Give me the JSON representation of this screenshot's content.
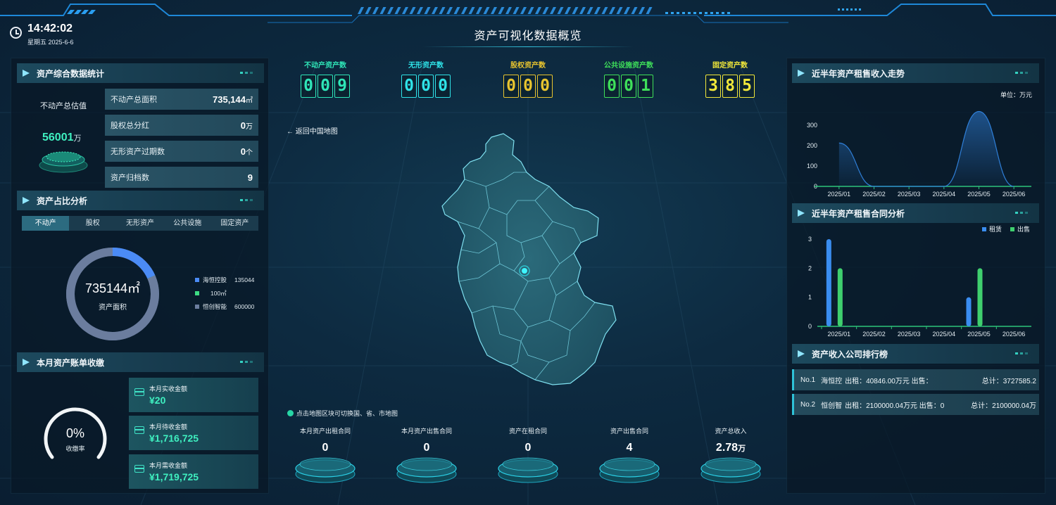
{
  "header": {
    "time": "14:42:02",
    "date": "星期五 2025-6-6",
    "title": "资产可视化数据概览"
  },
  "left": {
    "section_stats": "资产综合数据统计",
    "estimate_label": "不动产总估值",
    "estimate_value": "56001",
    "estimate_unit": "万",
    "stats": [
      {
        "label": "不动产总面积",
        "value": "735,144",
        "unit": "㎡"
      },
      {
        "label": "股权总分红",
        "value": "0",
        "unit": "万"
      },
      {
        "label": "无形资产过期数",
        "value": "0",
        "unit": "个"
      },
      {
        "label": "资产归档数",
        "value": "9",
        "unit": ""
      }
    ],
    "section_ratio": "资产占比分析",
    "tabs": [
      "不动产",
      "股权",
      "无形资产",
      "公共设施",
      "固定资产"
    ],
    "donut": {
      "value": "735144㎡",
      "label": "资产面积",
      "slices": [
        {
          "name": "海恒控股",
          "value": 135044,
          "display": "135044",
          "color": "#4b8bf5"
        },
        {
          "name": "",
          "value": 100,
          "display": "100㎡",
          "color": "#3ddc84"
        },
        {
          "name": "恒创智能",
          "value": 600000,
          "display": "600000",
          "color": "#6b7d9e"
        }
      ]
    },
    "section_bill": "本月资产账单收缴",
    "gauge": {
      "value": "0%",
      "label": "收缴率",
      "fraction": 0
    },
    "bills": [
      {
        "label": "本月实收金额",
        "value": "¥20"
      },
      {
        "label": "本月待收金额",
        "value": "¥1,716,725"
      },
      {
        "label": "本月需收金额",
        "value": "¥1,719,725"
      }
    ]
  },
  "center": {
    "counters": [
      {
        "label": "不动产资产数",
        "value": "009",
        "color": "#2fe6b8"
      },
      {
        "label": "无形资产数",
        "value": "000",
        "color": "#2fe3e8"
      },
      {
        "label": "股权资产数",
        "value": "000",
        "color": "#e8c42f"
      },
      {
        "label": "公共设施资产数",
        "value": "001",
        "color": "#3fe05a"
      },
      {
        "label": "固定资产数",
        "value": "385",
        "color": "#f2e83a"
      }
    ],
    "back_label": "返回中国地图",
    "tip": "点击地图区块可切换国、省、市地图",
    "pedestals": [
      {
        "label": "本月资产出租合同",
        "value": "0",
        "unit": ""
      },
      {
        "label": "本月资产出售合同",
        "value": "0",
        "unit": ""
      },
      {
        "label": "资产在租合同",
        "value": "0",
        "unit": ""
      },
      {
        "label": "资产出售合同",
        "value": "4",
        "unit": ""
      },
      {
        "label": "资产总收入",
        "value": "2.78",
        "unit": "万"
      }
    ]
  },
  "right": {
    "section_trend": "近半年资产租售收入走势",
    "unit": "单位：万元",
    "section_contract": "近半年资产租售合同分析",
    "section_rank": "资产收入公司排行榜",
    "ranking": [
      {
        "no": "No.1",
        "name": "海恒控",
        "detail": "出租：40846.00万元  出售：",
        "total": "总计：3727585.2"
      },
      {
        "no": "No.2",
        "name": "恒创智",
        "detail": "出租：2100000.04万元  出售：0",
        "total": "总计：2100000.04万"
      }
    ]
  },
  "chart_data": [
    {
      "type": "area",
      "categories": [
        "2025/01",
        "2025/02",
        "2025/03",
        "2025/04",
        "2025/05",
        "2025/06"
      ],
      "y_ticks": [
        "0",
        "100",
        "200",
        "300"
      ],
      "ylim": [
        0,
        380
      ],
      "series": [
        {
          "values": [
            213,
            0,
            0,
            0,
            368,
            0
          ],
          "color": "#2f7fd8"
        }
      ]
    },
    {
      "type": "bar",
      "categories": [
        "2025/01",
        "2025/02",
        "2025/03",
        "2025/04",
        "2025/05",
        "2025/06"
      ],
      "y_ticks": [
        "0",
        "1",
        "2",
        "3"
      ],
      "ylim": [
        0,
        3
      ],
      "legend": "top-right",
      "series": [
        {
          "name": "租赁",
          "values": [
            3,
            0,
            0,
            0,
            1,
            0
          ],
          "color": "#3a8df0"
        },
        {
          "name": "出售",
          "values": [
            2,
            0,
            0,
            0,
            2,
            0
          ],
          "color": "#3fcf6e"
        }
      ]
    }
  ]
}
